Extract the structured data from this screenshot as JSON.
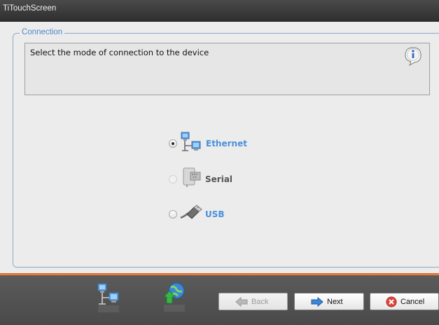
{
  "window": {
    "title": "TiTouchScreen"
  },
  "connection": {
    "legend": "Connection",
    "message": "Select the mode of connection to the device",
    "options": [
      {
        "label": "Ethernet",
        "selected": true,
        "enabled": true,
        "icon": "ethernet-network-icon"
      },
      {
        "label": "Serial",
        "selected": false,
        "enabled": false,
        "icon": "serial-port-icon"
      },
      {
        "label": "USB",
        "selected": false,
        "enabled": true,
        "icon": "usb-cable-icon"
      }
    ]
  },
  "footer": {
    "icons": [
      "network-computers-icon",
      "globe-upload-icon"
    ],
    "buttons": {
      "back": "Back",
      "next": "Next",
      "cancel": "Cancel"
    }
  },
  "colors": {
    "accent_orange": "#e2591c",
    "label_blue": "#4a90dd",
    "legend_blue": "#4f86c6"
  }
}
